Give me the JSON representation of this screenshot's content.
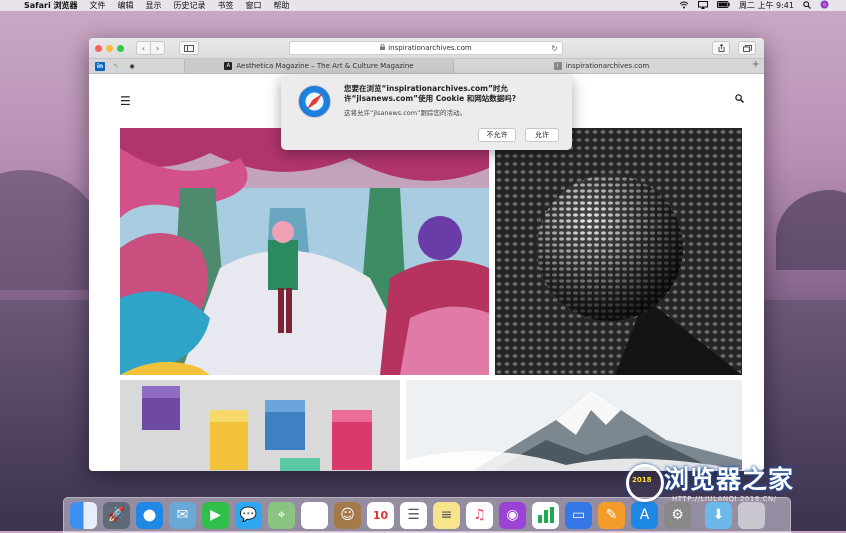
{
  "menubar": {
    "app": "Safari 浏览器",
    "items": [
      "文件",
      "编辑",
      "显示",
      "历史记录",
      "书签",
      "窗口",
      "帮助"
    ],
    "clock": "周二 上午 9:41"
  },
  "toolbar": {
    "address": "inspirationarchives.com"
  },
  "favorites": [
    "in",
    "",
    ""
  ],
  "tabs": [
    {
      "icon": "A",
      "title": "Aesthetica Magazine – The Art & Culture Magazine"
    },
    {
      "icon": "i",
      "title": "inspirationarchives.com"
    }
  ],
  "dialog": {
    "title": "您要在浏览“inspirationarchives.com”时允许“jlsanews.com”使用 Cookie 和网站数据吗?",
    "message": "这将允许“jlsanews.com”跟踪您的活动。",
    "deny": "不允许",
    "allow": "允许"
  },
  "dock": {
    "calendar_day": "10",
    "apps": [
      "finder",
      "launchpad",
      "safari",
      "mail",
      "facetime",
      "messages",
      "maps",
      "photos",
      "contacts",
      "calendar",
      "reminders",
      "notes",
      "music",
      "podcasts",
      "numbers",
      "keynote",
      "pages",
      "app-store",
      "system-preferences",
      "downloads",
      "trash"
    ]
  },
  "watermark": {
    "text": "浏览器之家",
    "year": "2018",
    "url": "HTTP://LIULANQI.2018.CN/"
  },
  "colors": {
    "accent": "#1e88e5",
    "close": "#fc605c",
    "minimize": "#fdbc40",
    "zoom": "#34c84a"
  }
}
